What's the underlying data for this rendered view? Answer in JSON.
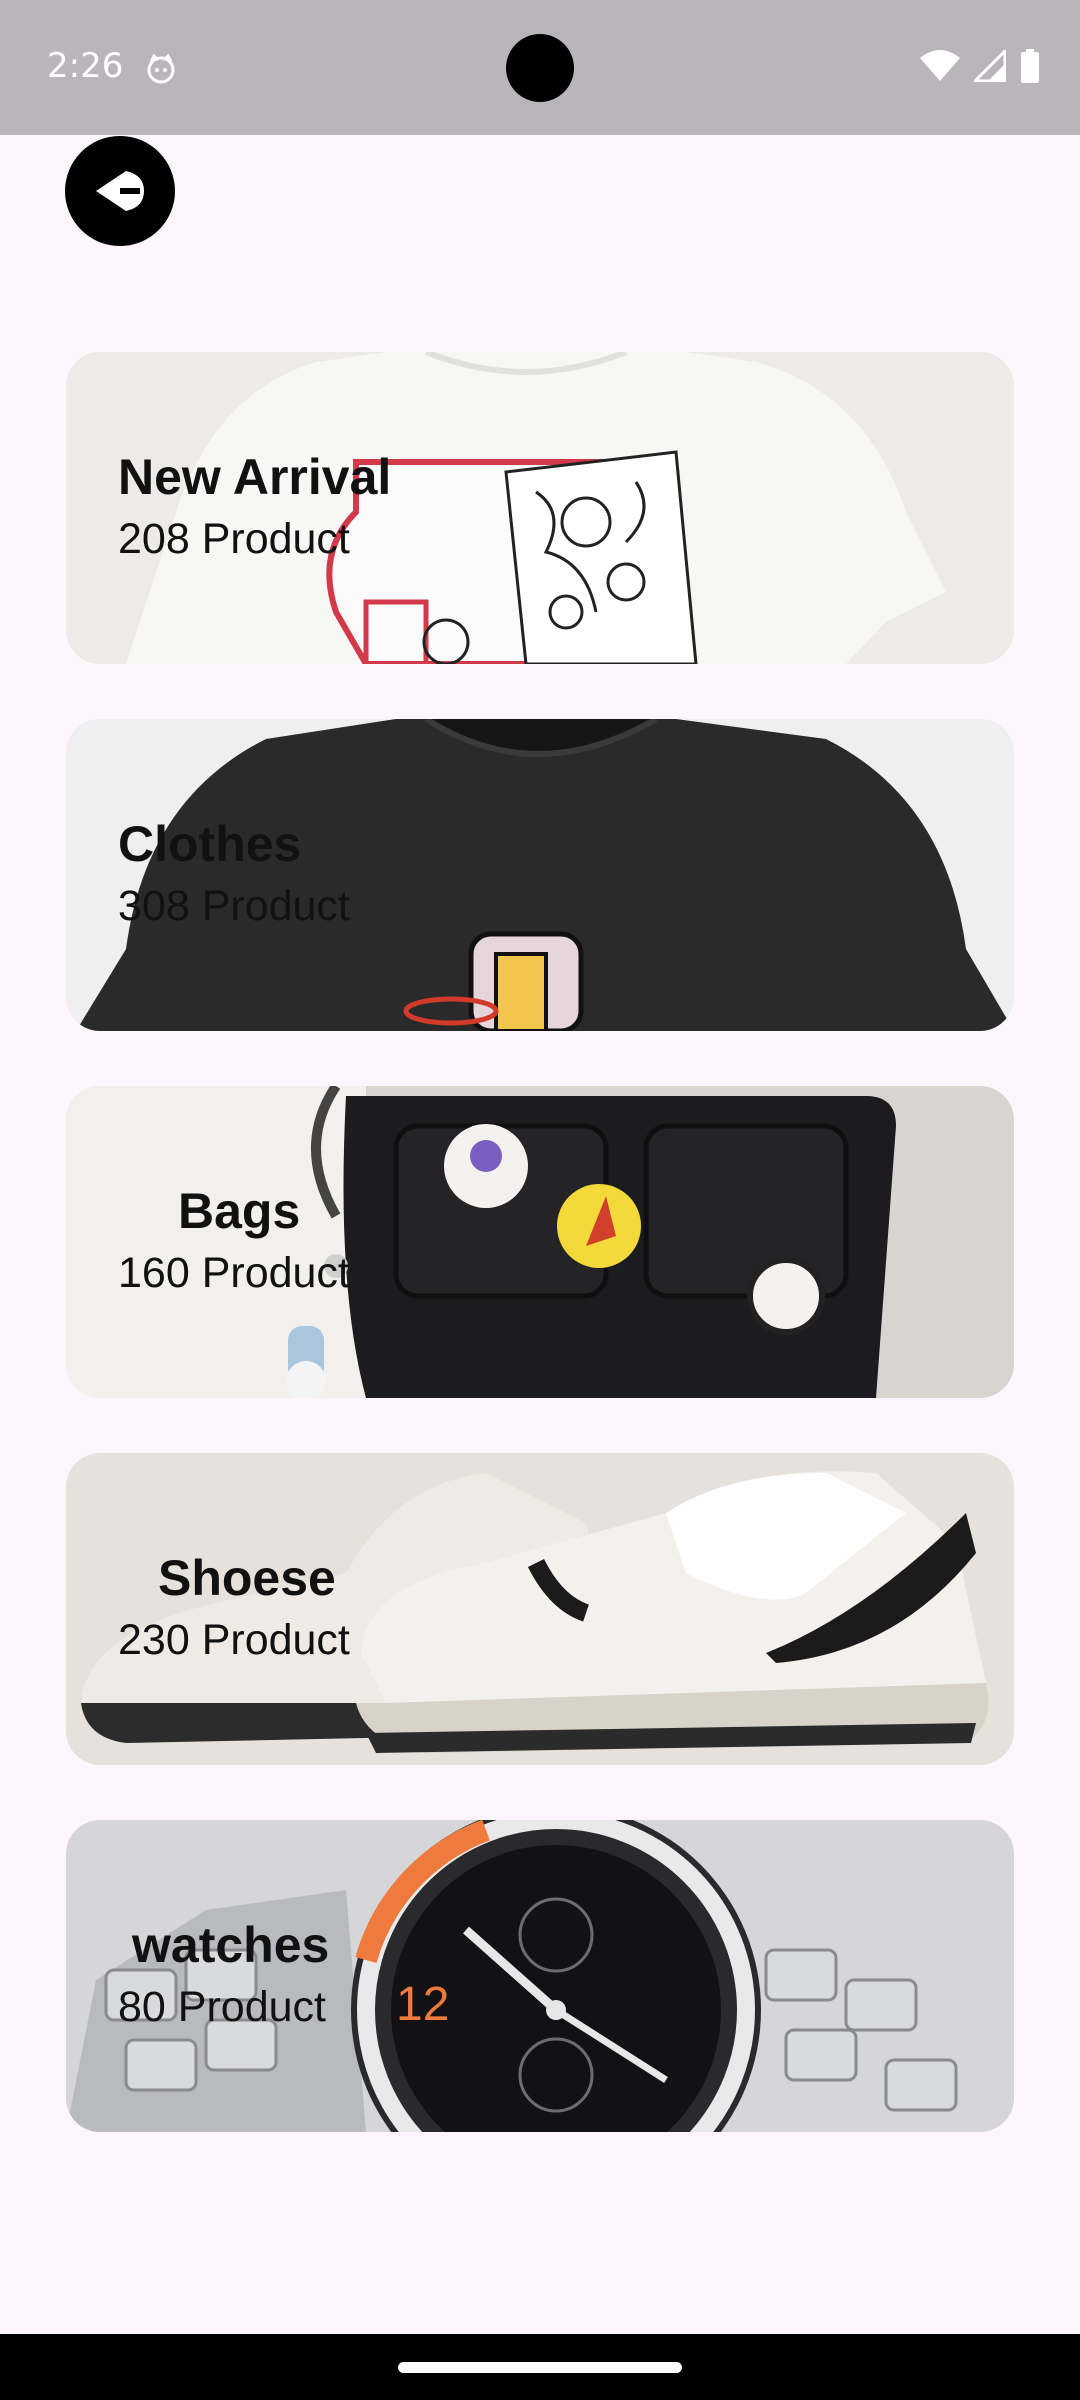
{
  "status_bar": {
    "time": "2:26",
    "icons": [
      "notification-cat-icon",
      "wifi-icon",
      "signal-icon",
      "battery-icon"
    ]
  },
  "header": {
    "back_icon": "back-arrow-icon"
  },
  "categories": [
    {
      "title": "New Arrival",
      "count": "208 Product",
      "image": "white-graphic-tshirt"
    },
    {
      "title": "Clothes",
      "count": "308 Product",
      "image": "black-tshirt"
    },
    {
      "title": "Bags",
      "count": "160 Product",
      "image": "black-shoulder-bag-with-pins"
    },
    {
      "title": "Shoese",
      "count": "230 Product",
      "image": "white-sneakers"
    },
    {
      "title": "watches",
      "count": "80 Product",
      "image": "chronograph-watch"
    }
  ],
  "colors": {
    "background": "#fdf6fd",
    "status_bar": "#b9b5bb",
    "text": "#111111",
    "back_button": "#000000"
  }
}
